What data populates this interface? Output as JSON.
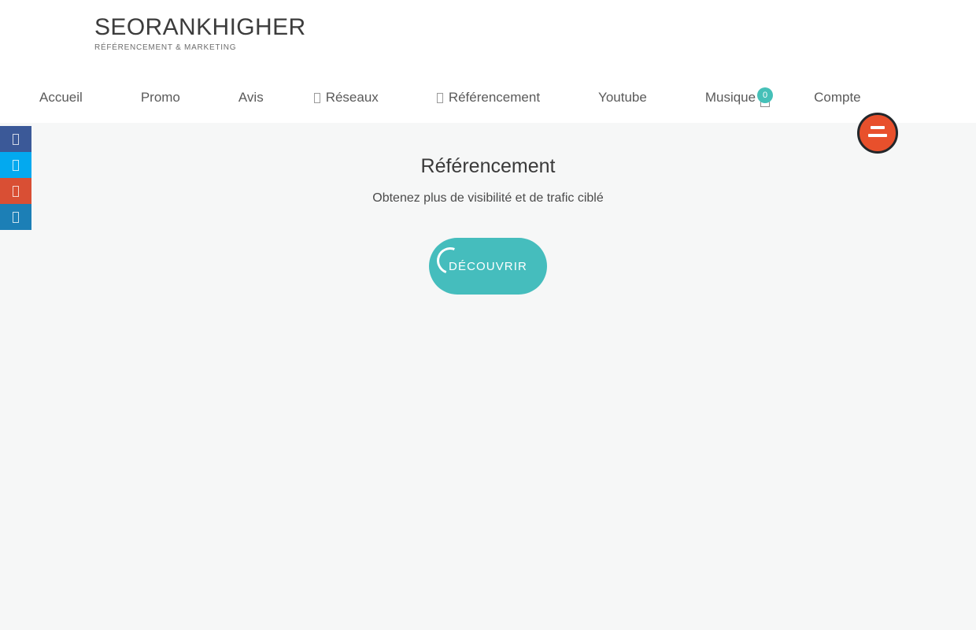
{
  "brand": {
    "title": "SEORANKHIGHER",
    "tagline": "RÉFÉRENCEMENT & MARKETING"
  },
  "nav": {
    "items": [
      {
        "label": "Accueil",
        "icon": null
      },
      {
        "label": "Promo",
        "icon": null
      },
      {
        "label": "Avis",
        "icon": null
      },
      {
        "label": "Réseaux",
        "icon": "missing-glyph-icon"
      },
      {
        "label": "Référencement",
        "icon": "missing-glyph-icon"
      },
      {
        "label": "Youtube",
        "icon": null
      },
      {
        "label": "Musique",
        "icon": null
      },
      {
        "label": "Compte",
        "icon": null
      }
    ],
    "cart": {
      "icon": "cart-icon",
      "badge_count": "0",
      "badge_color": "#45c0b8"
    }
  },
  "menu_toggle": {
    "icon": "hamburger-icon",
    "color": "#e8502c",
    "ring_color": "#23272b"
  },
  "social_rail": {
    "items": [
      {
        "name": "facebook",
        "icon": "facebook-icon",
        "color": "#3b5998"
      },
      {
        "name": "twitter",
        "icon": "twitter-icon",
        "color": "#03a9ef"
      },
      {
        "name": "google-plus",
        "icon": "google-plus-icon",
        "color": "#d94f34"
      },
      {
        "name": "linkedin",
        "icon": "linkedin-icon",
        "color": "#1c7fb6"
      }
    ]
  },
  "hero": {
    "title": "Référencement",
    "subtitle": "Obtenez plus de visibilité et de trafic ciblé",
    "cta_label": "DÉCOUVRIR",
    "cta_color": "#45bdbd",
    "spinner": "loading-spinner-icon"
  },
  "theme": {
    "header_background": "#ffffff",
    "page_background": "#f6f7f7",
    "text_color": "#4a4a4a",
    "accent_teal": "#45bdbd",
    "accent_orange": "#e8502c"
  }
}
